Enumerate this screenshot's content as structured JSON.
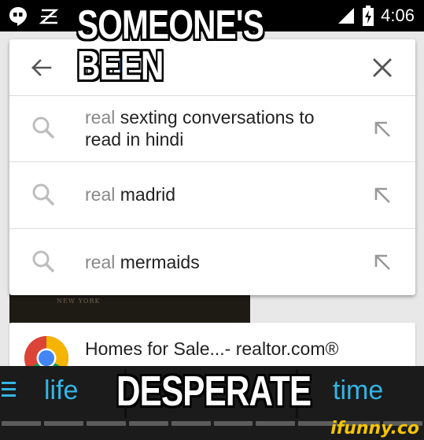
{
  "status_bar": {
    "time": "4:06",
    "icons": [
      "hangouts-icon",
      "zedge-icon",
      "signal-icon",
      "battery-charging-icon"
    ]
  },
  "search": {
    "query": "real",
    "back_icon": "arrow-left-icon",
    "clear_icon": "close-icon",
    "suggestions": [
      {
        "prefix": "real",
        "rest": " sexting conversations to read in hindi"
      },
      {
        "prefix": "real",
        "rest": " madrid"
      },
      {
        "prefix": "real",
        "rest": " mermaids"
      }
    ]
  },
  "background": {
    "image_caption": "NEW YORK",
    "card_title": "Homes for Sale...- realtor.com®"
  },
  "keyboard": {
    "suggestions": [
      "life",
      "time"
    ]
  },
  "meme": {
    "top": "SOMEONE'S BEEN",
    "bottom": "DESPERATE"
  },
  "watermark": "ifunny.co"
}
